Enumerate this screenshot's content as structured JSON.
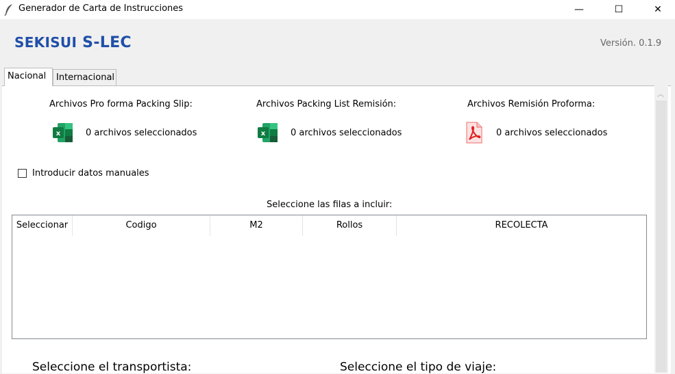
{
  "window": {
    "title": "Generador de Carta de Instrucciones",
    "controls": {
      "minimize": "—",
      "maximize": "☐",
      "close": "✕"
    }
  },
  "header": {
    "logo_part1": "SEKISUI",
    "logo_part2": "S-LEC",
    "version": "Versión. 0.1.9",
    "brand_color": "#1f4fa8"
  },
  "tabs": [
    {
      "label": "Nacional",
      "active": true
    },
    {
      "label": "Internacional",
      "active": false
    }
  ],
  "file_sections": [
    {
      "label": "Archivos Pro forma Packing Slip:",
      "icon": "excel-icon",
      "count_text": "0 archivos seleccionados"
    },
    {
      "label": "Archivos Packing List Remisión:",
      "icon": "excel-icon",
      "count_text": "0 archivos seleccionados"
    },
    {
      "label": "Archivos Remisión Proforma:",
      "icon": "pdf-icon",
      "count_text": "0 archivos seleccionados"
    }
  ],
  "manual_entry": {
    "label": "Introducir datos manuales",
    "checked": false
  },
  "rows_table": {
    "label": "Seleccione las filas a incluir:",
    "columns": [
      "Seleccionar",
      "Codigo",
      "M2",
      "Rollos",
      "RECOLECTA"
    ],
    "rows": []
  },
  "bottom": {
    "carrier_label": "Seleccione el transportista:",
    "trip_type_label": "Seleccione el tipo de viaje:"
  }
}
